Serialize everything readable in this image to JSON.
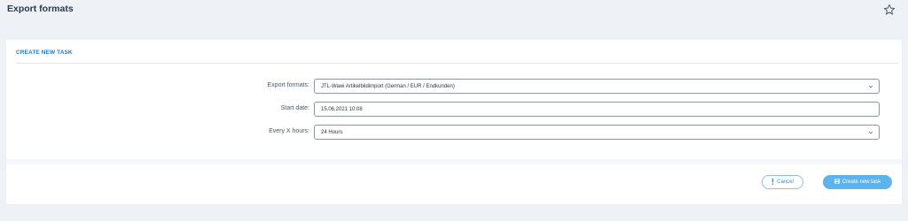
{
  "header": {
    "title": "Export formats",
    "favorite_icon": "star-icon"
  },
  "card": {
    "heading": "CREATE NEW TASK"
  },
  "form": {
    "export_formats": {
      "label": "Export formats:",
      "value": "JTL-Wawi Artikelbildimport (German / EUR / Endkunden)"
    },
    "start_date": {
      "label": "Start date:",
      "value": "15.06.2021 10:08"
    },
    "every_x_hours": {
      "label": "Every X hours:",
      "value": "24 Hours"
    }
  },
  "actions": {
    "cancel_label": "Cancel",
    "cancel_icon": "exclamation-icon",
    "create_label": "Create new task",
    "create_icon": "save-icon"
  },
  "colors": {
    "accent": "#2a7ab8",
    "button_primary": "#5eb3e8",
    "page_background": "#eef1f5"
  }
}
